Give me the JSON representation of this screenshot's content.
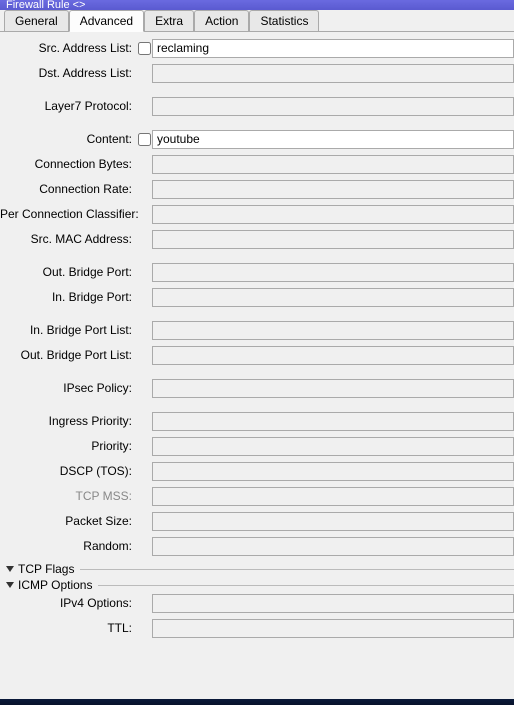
{
  "window": {
    "title": "Firewall Rule <>"
  },
  "tabs": {
    "general": "General",
    "advanced": "Advanced",
    "extra": "Extra",
    "action": "Action",
    "statistics": "Statistics"
  },
  "fields": {
    "src_address_list": {
      "label": "Src. Address List:",
      "value": "reclaming"
    },
    "dst_address_list": {
      "label": "Dst. Address List:",
      "value": ""
    },
    "layer7_protocol": {
      "label": "Layer7 Protocol:",
      "value": ""
    },
    "content": {
      "label": "Content:",
      "value": "youtube"
    },
    "connection_bytes": {
      "label": "Connection Bytes:",
      "value": ""
    },
    "connection_rate": {
      "label": "Connection Rate:",
      "value": ""
    },
    "per_connection_classifier": {
      "label": "Per Connection Classifier:",
      "value": ""
    },
    "src_mac_address": {
      "label": "Src. MAC Address:",
      "value": ""
    },
    "out_bridge_port": {
      "label": "Out. Bridge Port:",
      "value": ""
    },
    "in_bridge_port": {
      "label": "In. Bridge Port:",
      "value": ""
    },
    "in_bridge_port_list": {
      "label": "In. Bridge Port List:",
      "value": ""
    },
    "out_bridge_port_list": {
      "label": "Out. Bridge Port List:",
      "value": ""
    },
    "ipsec_policy": {
      "label": "IPsec Policy:",
      "value": ""
    },
    "ingress_priority": {
      "label": "Ingress Priority:",
      "value": ""
    },
    "priority": {
      "label": "Priority:",
      "value": ""
    },
    "dscp_tos": {
      "label": "DSCP (TOS):",
      "value": ""
    },
    "tcp_mss": {
      "label": "TCP MSS:",
      "value": ""
    },
    "packet_size": {
      "label": "Packet Size:",
      "value": ""
    },
    "random": {
      "label": "Random:",
      "value": ""
    },
    "ipv4_options": {
      "label": "IPv4 Options:",
      "value": ""
    },
    "ttl": {
      "label": "TTL:",
      "value": ""
    }
  },
  "groups": {
    "tcp_flags": "TCP Flags",
    "icmp_options": "ICMP Options"
  }
}
